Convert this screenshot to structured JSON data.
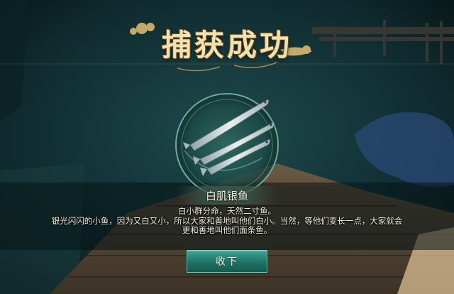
{
  "dialog": {
    "title": "捕获成功",
    "fish_name": "白肌银鱼",
    "description_lines": [
      "白小群分命，天然二寸鱼。",
      "银光闪闪的小鱼，因为又白又小，所以大家和善地叫他们白小。当然，等他们变长一点，大家就会",
      "更和善地叫他们面条鱼。"
    ],
    "collect_label": "收下"
  },
  "icons": {
    "fish": "silver-fish-icon",
    "cloud": "gold-cloud-ornament"
  },
  "colors": {
    "title_gold": "#f1e2b4",
    "button_teal": "#1f7266",
    "water": "#123236"
  }
}
